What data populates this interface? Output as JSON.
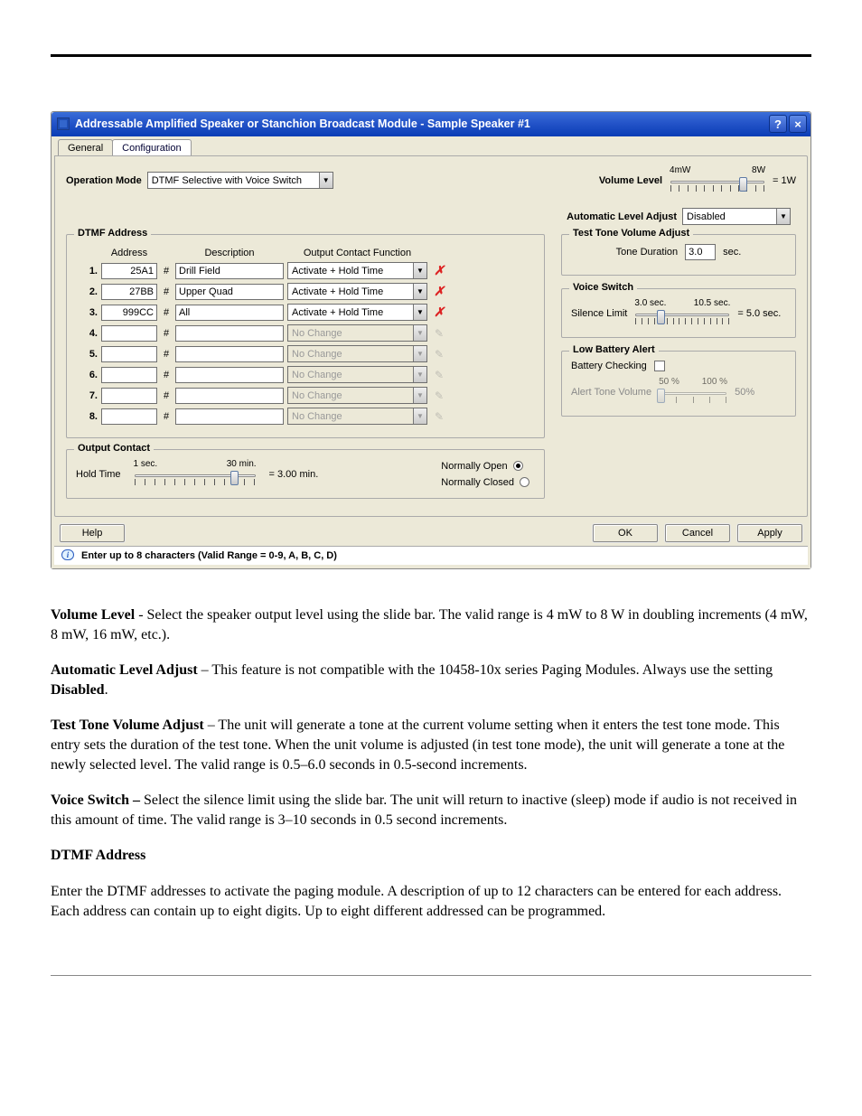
{
  "window": {
    "title": "Addressable Amplified Speaker or Stanchion Broadcast Module - Sample Speaker #1"
  },
  "tabs": {
    "general": "General",
    "configuration": "Configuration"
  },
  "panel": {
    "operation_mode_label": "Operation Mode",
    "operation_mode_value": "DTMF Selective with Voice Switch",
    "volume_level_label": "Volume Level",
    "volume_slider_min_label": "4mW",
    "volume_slider_max_label": "8W",
    "volume_value_text": "= 1W",
    "ala_label": "Automatic Level Adjust",
    "ala_value": "Disabled"
  },
  "dtmf": {
    "group_title": "DTMF Address",
    "col_address": "Address",
    "col_description": "Description",
    "col_output": "Output Contact Function",
    "hash": "#",
    "rows": [
      {
        "idx": "1.",
        "address": "25A1",
        "desc": "Drill Field",
        "func": "Activate + Hold Time",
        "delx": true,
        "disabled": false
      },
      {
        "idx": "2.",
        "address": "27BB",
        "desc": "Upper Quad",
        "func": "Activate + Hold Time",
        "delx": true,
        "disabled": false
      },
      {
        "idx": "3.",
        "address": "999CC",
        "desc": "All",
        "func": "Activate + Hold Time",
        "delx": true,
        "disabled": false
      },
      {
        "idx": "4.",
        "address": "",
        "desc": "",
        "func": "No Change",
        "delx": false,
        "disabled": true
      },
      {
        "idx": "5.",
        "address": "",
        "desc": "",
        "func": "No Change",
        "delx": false,
        "disabled": true
      },
      {
        "idx": "6.",
        "address": "",
        "desc": "",
        "func": "No Change",
        "delx": false,
        "disabled": true
      },
      {
        "idx": "7.",
        "address": "",
        "desc": "",
        "func": "No Change",
        "delx": false,
        "disabled": true
      },
      {
        "idx": "8.",
        "address": "",
        "desc": "",
        "func": "No Change",
        "delx": false,
        "disabled": true
      }
    ]
  },
  "test_tone": {
    "group_title": "Test Tone Volume Adjust",
    "tone_duration_label": "Tone Duration",
    "tone_duration_value": "3.0",
    "tone_duration_unit": "sec."
  },
  "voice_switch": {
    "group_title": "Voice Switch",
    "silence_limit_label": "Silence Limit",
    "slider_min": "3.0 sec.",
    "slider_max": "10.5 sec.",
    "value_text": "= 5.0 sec."
  },
  "low_battery": {
    "group_title": "Low Battery Alert",
    "battery_checking_label": "Battery Checking",
    "alert_tone_label": "Alert Tone Volume",
    "slider_min": "50 %",
    "slider_max": "100 %",
    "value_text": "50%"
  },
  "output_contact": {
    "group_title": "Output Contact",
    "hold_time_label": "Hold Time",
    "slider_min": "1 sec.",
    "slider_max": "30 min.",
    "value_text": "= 3.00 min.",
    "normally_open": "Normally Open",
    "normally_closed": "Normally Closed"
  },
  "footer": {
    "help": "Help",
    "ok": "OK",
    "cancel": "Cancel",
    "apply": "Apply"
  },
  "infobar": {
    "text": "Enter up to 8 characters (Valid Range = 0-9, A, B, C, D)"
  },
  "prose": {
    "p1a": "Volume Level",
    "p1b": " - Select the speaker output level using the slide bar.  The valid range is 4 mW to 8 W in doubling increments (4 mW, 8 mW, 16 mW, etc.).",
    "p2a": "Automatic Level Adjust",
    "p2b": " – This feature is not compatible with the 10458-10x series Paging Modules.  Always use the setting ",
    "p2c": "Disabled",
    "p2d": ".",
    "p3a": "Test Tone Volume Adjust",
    "p3b": " – The unit will generate a tone at the current volume setting when it enters the test tone mode.  This entry sets the duration of the test tone.  When the unit volume is adjusted (in test tone mode), the unit will generate a tone at the newly selected level.  The valid range is 0.5–6.0 seconds in 0.5-second increments.",
    "p4a": "Voice Switch – ",
    "p4b": "Select the silence limit using the slide bar.  The unit will return to inactive (sleep) mode if audio is not received in this amount of time.  The valid range is 3–10 seconds in 0.5 second increments.",
    "p5a": "DTMF Address",
    "p6": "Enter the DTMF addresses to activate the paging module.  A description of up to 12 characters can be entered for each address.  Each address can contain up to eight digits.  Up to eight different addressed can be programmed."
  }
}
